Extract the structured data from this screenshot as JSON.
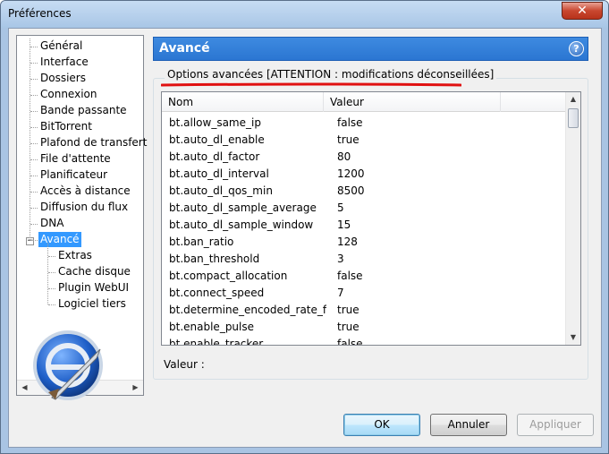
{
  "window": {
    "title": "Préférences",
    "close_symbol": "✕"
  },
  "tree": {
    "items": [
      {
        "label": "Général"
      },
      {
        "label": "Interface"
      },
      {
        "label": "Dossiers"
      },
      {
        "label": "Connexion"
      },
      {
        "label": "Bande passante"
      },
      {
        "label": "BitTorrent"
      },
      {
        "label": "Plafond de transfert"
      },
      {
        "label": "File d'attente"
      },
      {
        "label": "Planificateur"
      },
      {
        "label": "Accès à distance"
      },
      {
        "label": "Diffusion du flux"
      },
      {
        "label": "DNA"
      },
      {
        "label": "Avancé",
        "selected": true,
        "expanded": true
      }
    ],
    "children": [
      {
        "label": "Extras"
      },
      {
        "label": "Cache disque"
      },
      {
        "label": "Plugin WebUI"
      },
      {
        "label": "Logiciel tiers"
      }
    ],
    "expander_symbol": "−"
  },
  "panel": {
    "title": "Avancé",
    "help_icon": "?",
    "group_label": "Options avancées [ATTENTION : modifications déconseillées]",
    "value_label": "Valeur :"
  },
  "list": {
    "columns": [
      "Nom",
      "Valeur"
    ],
    "rows": [
      {
        "name": "bt.allow_same_ip",
        "value": "false"
      },
      {
        "name": "bt.auto_dl_enable",
        "value": "true"
      },
      {
        "name": "bt.auto_dl_factor",
        "value": "80"
      },
      {
        "name": "bt.auto_dl_interval",
        "value": "1200"
      },
      {
        "name": "bt.auto_dl_qos_min",
        "value": "8500"
      },
      {
        "name": "bt.auto_dl_sample_average",
        "value": "5"
      },
      {
        "name": "bt.auto_dl_sample_window",
        "value": "15"
      },
      {
        "name": "bt.ban_ratio",
        "value": "128"
      },
      {
        "name": "bt.ban_threshold",
        "value": "3"
      },
      {
        "name": "bt.compact_allocation",
        "value": "false"
      },
      {
        "name": "bt.connect_speed",
        "value": "7"
      },
      {
        "name": "bt.determine_encoded_rate_fo...",
        "value": "true"
      },
      {
        "name": "bt.enable_pulse",
        "value": "true"
      },
      {
        "name": "bt.enable_tracker",
        "value": "false"
      }
    ]
  },
  "buttons": {
    "ok": "OK",
    "cancel": "Annuler",
    "apply": "Appliquer"
  },
  "colors": {
    "header": "#2b76d2",
    "selection": "#3399ff",
    "annotation": "#e01010"
  }
}
